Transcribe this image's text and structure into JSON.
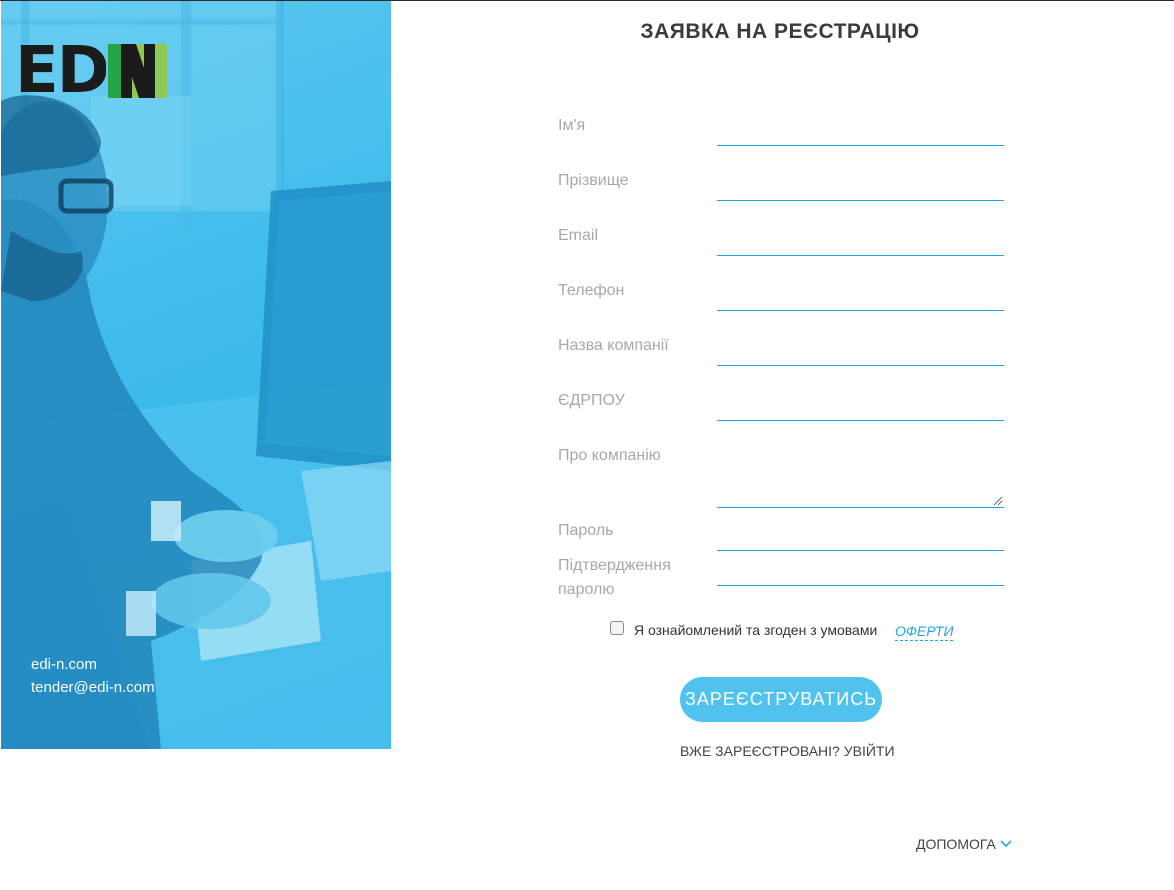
{
  "brand": {
    "logo_text": "EDIN",
    "logo_ed": "ED",
    "contacts": [
      "edi-n.com",
      "tender@edi-n.com"
    ]
  },
  "form": {
    "title": "ЗАЯВКА НА РЕЄСТРАЦІЮ",
    "fields": [
      {
        "label": "Ім'я",
        "value": ""
      },
      {
        "label": "Прізвище",
        "value": ""
      },
      {
        "label": "Email",
        "value": ""
      },
      {
        "label": "Телефон",
        "value": ""
      },
      {
        "label": "Назва компанії",
        "value": ""
      },
      {
        "label": "ЄДРПОУ",
        "value": ""
      },
      {
        "label": "Про компанію",
        "value": ""
      },
      {
        "label": "Пароль",
        "value": ""
      },
      {
        "label_line1": "Підтвердження",
        "label_line2": "паролю",
        "value": ""
      }
    ],
    "agree_text": "Я ознайомлений та згоден з умовами",
    "offer_link": "ОФЕРТИ",
    "agree_checked": false,
    "register_button": "ЗАРЕЄСТРУВАТИСЬ",
    "login_link": "ВЖЕ ЗАРЕЄСТРОВАНІ? УВІЙТИ"
  },
  "footer": {
    "help_label": "ДОПОМОГА",
    "help_icon": "chevron-down-icon"
  },
  "colors": {
    "accent": "#4fc3ee",
    "input_line": "#1aa5de",
    "link": "#23a6df",
    "panel": "#3ebbec"
  }
}
